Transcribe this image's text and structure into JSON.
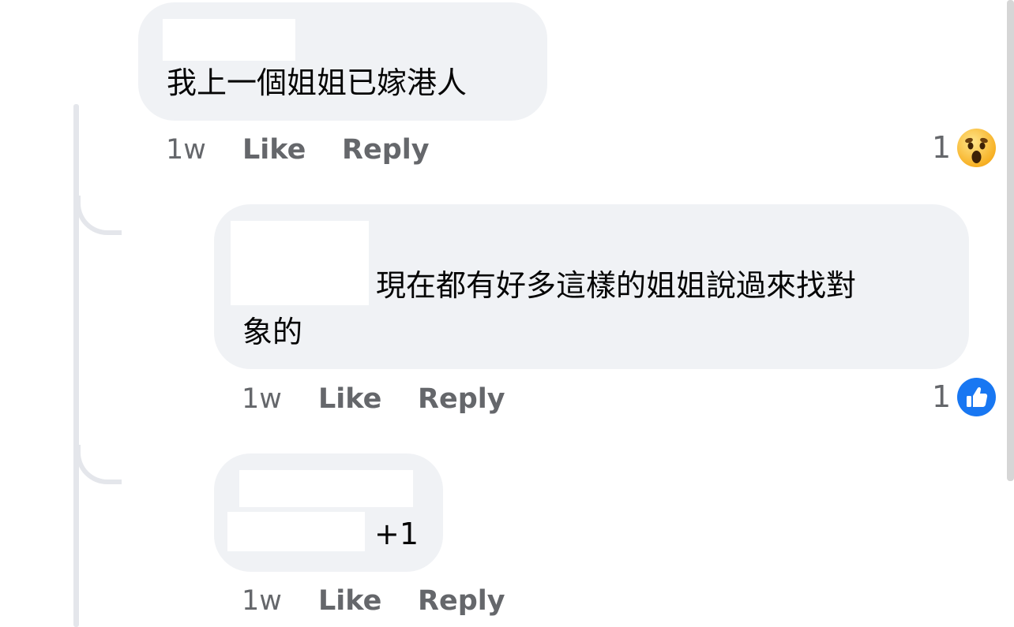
{
  "comments": [
    {
      "text": "我上一個姐姐已嫁港人",
      "time": "1w",
      "like_label": "Like",
      "reply_label": "Reply",
      "reaction": {
        "type": "wow",
        "count": "1"
      }
    },
    {
      "text_line1": "現在都有好多這樣的姐姐說過來找對",
      "text_line2": "象的",
      "time": "1w",
      "like_label": "Like",
      "reply_label": "Reply",
      "reaction": {
        "type": "like",
        "count": "1",
        "color": "#1877f2"
      }
    },
    {
      "text": "+1",
      "time": "1w",
      "like_label": "Like",
      "reply_label": "Reply"
    }
  ],
  "colors": {
    "bubble": "#f0f2f5",
    "meta": "#65676b",
    "thread_line": "#e4e6eb",
    "like_blue": "#1877f2",
    "wow_yellow": "#f7b125"
  }
}
